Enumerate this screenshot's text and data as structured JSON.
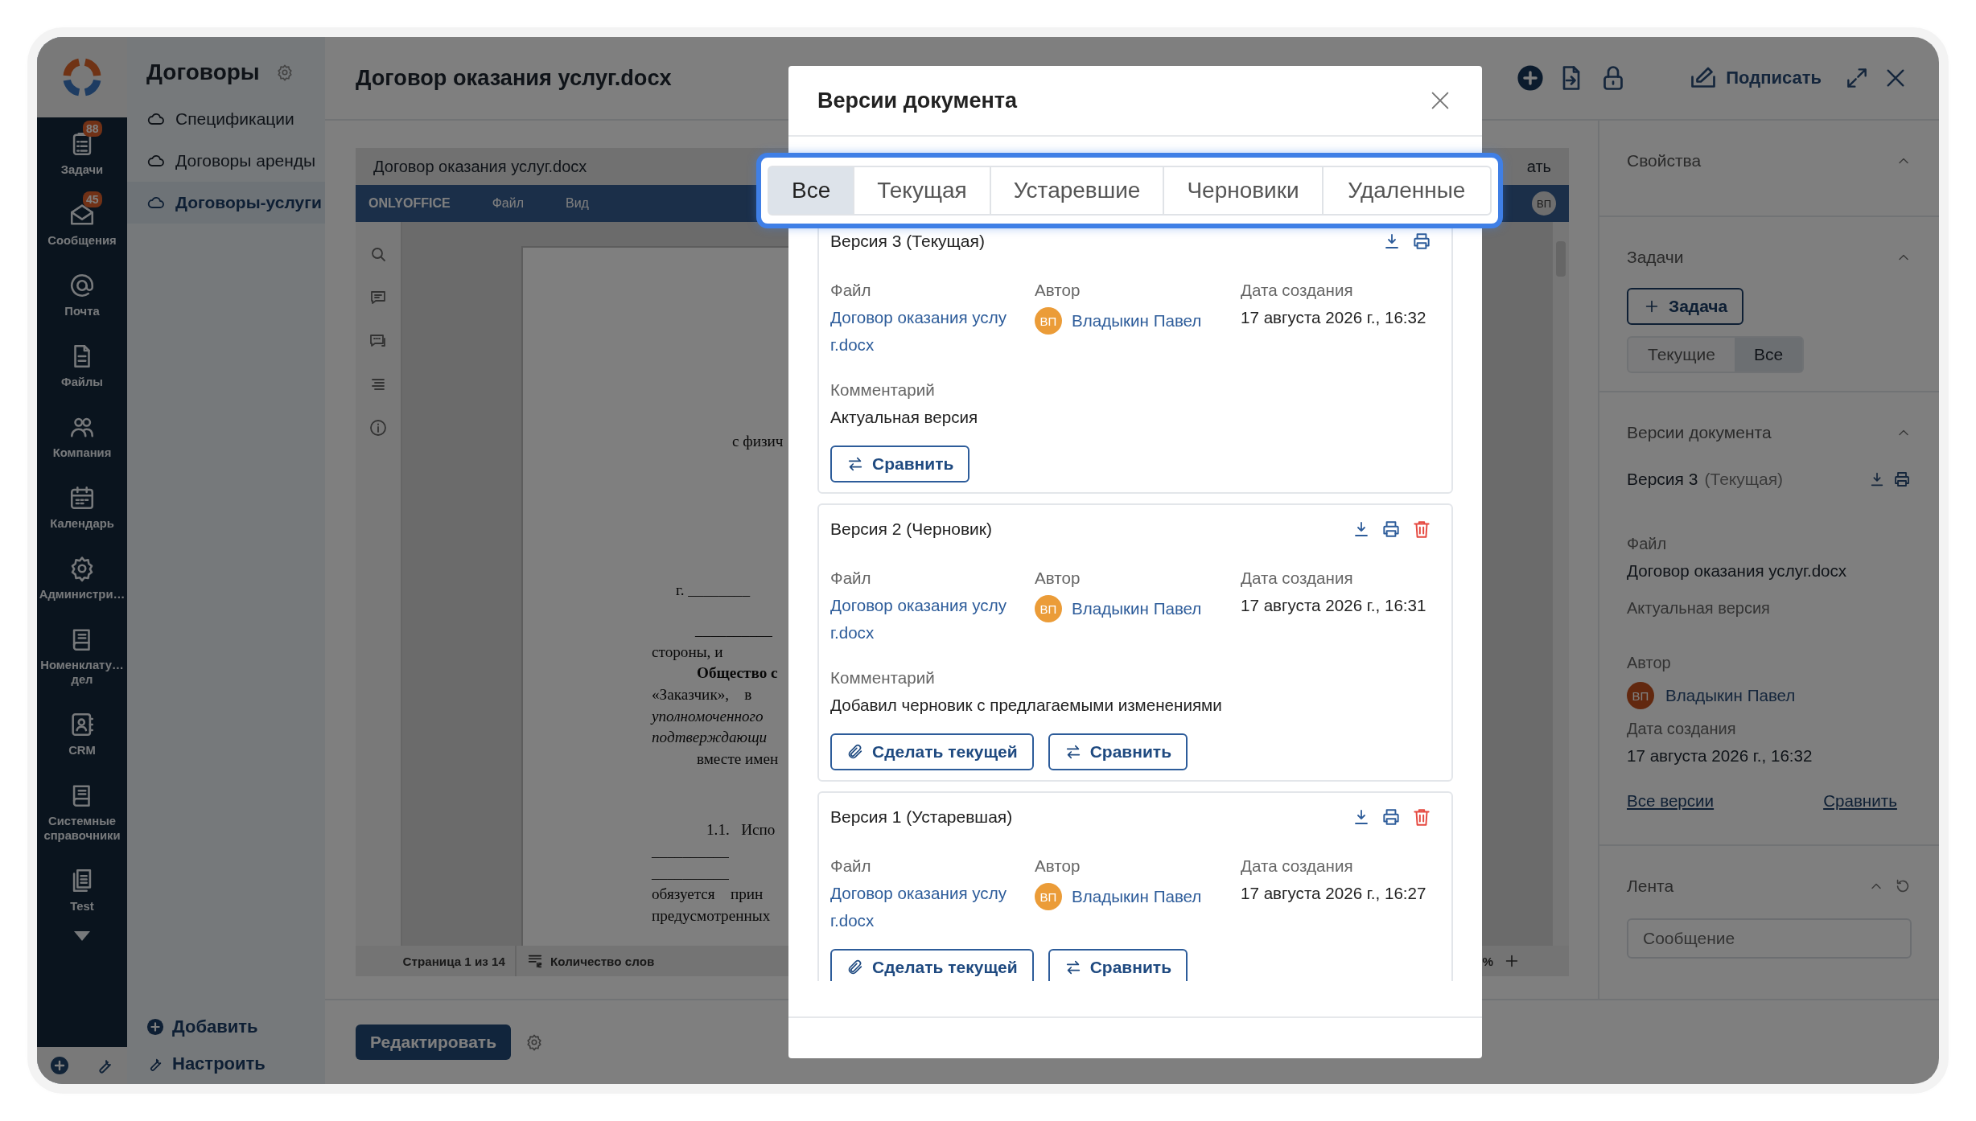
{
  "rail": {
    "items": [
      {
        "label": "Задачи",
        "badge": "88"
      },
      {
        "label": "Сообщения",
        "badge": "45"
      },
      {
        "label": "Почта"
      },
      {
        "label": "Файлы"
      },
      {
        "label": "Компания"
      },
      {
        "label": "Календарь"
      },
      {
        "label": "Администри…"
      },
      {
        "label": "Номенклату… дел"
      },
      {
        "label": "CRM"
      },
      {
        "label": "Системные справочники"
      },
      {
        "label": "Test"
      }
    ]
  },
  "nav": {
    "title": "Договоры",
    "items": [
      {
        "label": "Спецификации",
        "selected": false
      },
      {
        "label": "Договоры аренды",
        "selected": false
      },
      {
        "label": "Договоры-услуги",
        "selected": true
      }
    ],
    "actions": [
      "Добавить",
      "Настроить"
    ]
  },
  "header": {
    "title": "Договор оказания услуг.docx",
    "sign_button": "Подписать"
  },
  "viewer": {
    "file_title": "Договор оказания услуг.docx",
    "brand": "ONLYOFFICE",
    "menu": [
      "Файл",
      "Вид"
    ],
    "cut_label": "ать",
    "avatar": "ВП",
    "page_lines": [
      {
        "text": "с физич",
        "kind": "center"
      },
      {
        "text": "г. ________",
        "kind": "date"
      },
      {
        "text": "__________",
        "kind": "signature"
      },
      {
        "text": "стороны, и",
        "kind": "body"
      },
      {
        "text": "Общество с",
        "kind": "lead-bold"
      },
      {
        "text": "«Заказчик»,    в",
        "kind": "body"
      },
      {
        "text": "уполномоченного",
        "kind": "italic"
      },
      {
        "text": "подтверждающи",
        "kind": "italic"
      },
      {
        "text": "вместе имен",
        "kind": "lead"
      },
      {
        "text": "1.1.   Испо",
        "kind": "section"
      },
      {
        "text": "__________",
        "kind": "body"
      },
      {
        "text": "__________",
        "kind": "body"
      },
      {
        "text": "обязуется    прин",
        "kind": "body"
      },
      {
        "text": "предусмотренных",
        "kind": "body"
      }
    ],
    "status": {
      "page": "Страница 1 из 14",
      "words": "Количество слов",
      "zoom": "%"
    }
  },
  "edit_button": "Редактировать",
  "panel": {
    "properties": {
      "title": "Свойства"
    },
    "tasks": {
      "title": "Задачи",
      "add_button": "Задача",
      "filter": [
        {
          "label": "Текущие",
          "selected": false
        },
        {
          "label": "Все",
          "selected": true
        }
      ]
    },
    "versions": {
      "title": "Версии документа",
      "version_title": "Версия 3",
      "version_status": "(Текущая)",
      "file_label": "Файл",
      "file_name": "Договор оказания услуг.docx",
      "comment": "Актуальная версия",
      "author_label": "Автор",
      "author_initials": "ВП",
      "author": "Владыкин Павел",
      "date_label": "Дата создания",
      "date": "17 августа 2026 г., 16:32",
      "links": [
        "Все версии",
        "Сравнить"
      ]
    },
    "feed": {
      "title": "Лента",
      "placeholder": "Сообщение"
    }
  },
  "modal": {
    "title": "Версии документа",
    "tabs": [
      {
        "label": "Все",
        "selected": true
      },
      {
        "label": "Текущая",
        "selected": false
      },
      {
        "label": "Устаревшие",
        "selected": false
      },
      {
        "label": "Черновики",
        "selected": false
      },
      {
        "label": "Удаленные",
        "selected": false
      }
    ],
    "versions": [
      {
        "title": "Версия 3 (Текущая)",
        "deletable": false,
        "labels": {
          "file": "Файл",
          "author": "Автор",
          "date": "Дата создания",
          "comment": "Комментарий"
        },
        "file": "Договор оказания услуг.docx",
        "author_initials": "ВП",
        "author": "Владыкин Павел",
        "date": "17 августа 2026 г., 16:32",
        "comment": "Актуальная версия",
        "buttons": [
          {
            "label": "Сравнить",
            "kind": "compare"
          }
        ]
      },
      {
        "title": "Версия 2 (Черновик)",
        "deletable": true,
        "labels": {
          "file": "Файл",
          "author": "Автор",
          "date": "Дата создания",
          "comment": "Комментарий"
        },
        "file": "Договор оказания услуг.docx",
        "author_initials": "ВП",
        "author": "Владыкин Павел",
        "date": "17 августа 2026 г., 16:31",
        "comment": "Добавил черновик с предлагаемыми изменениями",
        "buttons": [
          {
            "label": "Сделать текущей",
            "kind": "make-current"
          },
          {
            "label": "Сравнить",
            "kind": "compare"
          }
        ]
      },
      {
        "title": "Версия 1 (Устаревшая)",
        "deletable": true,
        "labels": {
          "file": "Файл",
          "author": "Автор",
          "date": "Дата создания"
        },
        "file": "Договор оказания услуг.docx",
        "author_initials": "ВП",
        "author": "Владыкин Павел",
        "date": "17 августа 2026 г., 16:27",
        "buttons": [
          {
            "label": "Сделать текущей",
            "kind": "make-current"
          },
          {
            "label": "Сравнить",
            "kind": "compare"
          }
        ]
      }
    ]
  }
}
